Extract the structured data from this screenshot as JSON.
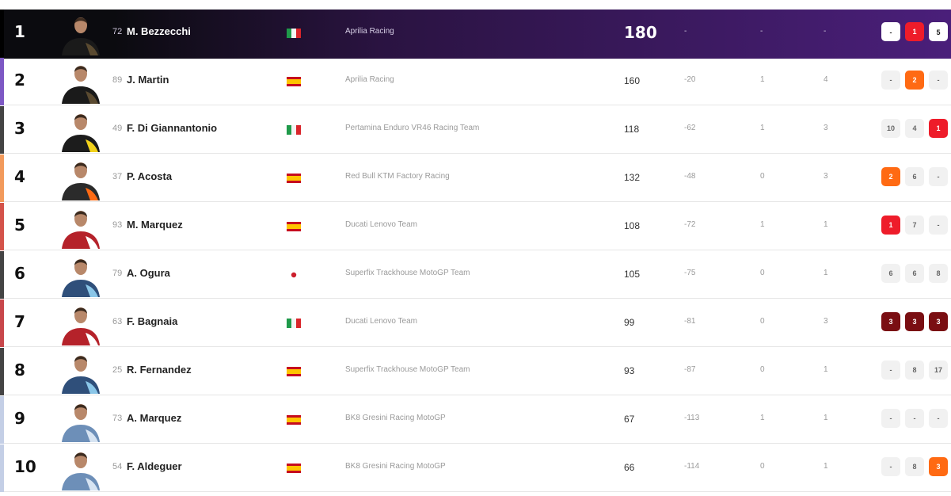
{
  "colors": {
    "leader_bg": "#2a1341",
    "row_accents": [
      "#000000",
      "#7d58c4",
      "#444444",
      "#f29a5c",
      "#d4534a",
      "#444444",
      "#c8474b",
      "#444444",
      "#c4cfe6",
      "#c4cfe6"
    ],
    "form_orange": "#ff6a13",
    "form_red": "#ee1c2a",
    "form_darkred": "#7a0e12",
    "form_grey": "#ececec"
  },
  "rows": [
    {
      "pos": "1",
      "num": "72",
      "rider": "M. Bezzecchi",
      "flag": "it",
      "team": "Aprilia Racing",
      "pts": "180",
      "gap": "-",
      "wins": "-",
      "pods": "-",
      "avatar": "black",
      "form": [
        {
          "label": "-",
          "style": "white"
        },
        {
          "label": "1",
          "style": "red"
        },
        {
          "label": "5",
          "style": "white"
        }
      ]
    },
    {
      "pos": "2",
      "num": "89",
      "rider": "J. Martin",
      "flag": "es",
      "team": "Aprilia Racing",
      "pts": "160",
      "gap": "-20",
      "wins": "1",
      "pods": "4",
      "avatar": "black",
      "form": [
        {
          "label": "-",
          "style": "grey"
        },
        {
          "label": "2",
          "style": "orange"
        },
        {
          "label": "-",
          "style": "grey"
        }
      ]
    },
    {
      "pos": "3",
      "num": "49",
      "rider": "F. Di Giannantonio",
      "flag": "it",
      "team": "Pertamina Enduro VR46 Racing Team",
      "pts": "118",
      "gap": "-62",
      "wins": "1",
      "pods": "3",
      "avatar": "yellow",
      "form": [
        {
          "label": "10",
          "style": "grey"
        },
        {
          "label": "4",
          "style": "grey"
        },
        {
          "label": "1",
          "style": "red"
        }
      ]
    },
    {
      "pos": "4",
      "num": "37",
      "rider": "P. Acosta",
      "flag": "es",
      "team": "Red Bull KTM Factory Racing",
      "pts": "132",
      "gap": "-48",
      "wins": "0",
      "pods": "3",
      "avatar": "orange",
      "form": [
        {
          "label": "2",
          "style": "orange"
        },
        {
          "label": "6",
          "style": "grey"
        },
        {
          "label": "-",
          "style": "grey"
        }
      ]
    },
    {
      "pos": "5",
      "num": "93",
      "rider": "M. Marquez",
      "flag": "es",
      "team": "Ducati Lenovo Team",
      "pts": "108",
      "gap": "-72",
      "wins": "1",
      "pods": "1",
      "avatar": "red",
      "form": [
        {
          "label": "1",
          "style": "red"
        },
        {
          "label": "7",
          "style": "grey"
        },
        {
          "label": "-",
          "style": "grey"
        }
      ]
    },
    {
      "pos": "6",
      "num": "79",
      "rider": "A. Ogura",
      "flag": "jp",
      "team": "Superfix Trackhouse MotoGP Team",
      "pts": "105",
      "gap": "-75",
      "wins": "0",
      "pods": "1",
      "avatar": "blue",
      "form": [
        {
          "label": "6",
          "style": "grey"
        },
        {
          "label": "6",
          "style": "grey"
        },
        {
          "label": "8",
          "style": "grey"
        }
      ]
    },
    {
      "pos": "7",
      "num": "63",
      "rider": "F. Bagnaia",
      "flag": "it",
      "team": "Ducati Lenovo Team",
      "pts": "99",
      "gap": "-81",
      "wins": "0",
      "pods": "3",
      "avatar": "red",
      "form": [
        {
          "label": "3",
          "style": "darkred"
        },
        {
          "label": "3",
          "style": "darkred"
        },
        {
          "label": "3",
          "style": "darkred"
        }
      ]
    },
    {
      "pos": "8",
      "num": "25",
      "rider": "R. Fernandez",
      "flag": "es",
      "team": "Superfix Trackhouse MotoGP Team",
      "pts": "93",
      "gap": "-87",
      "wins": "0",
      "pods": "1",
      "avatar": "blue",
      "form": [
        {
          "label": "-",
          "style": "grey"
        },
        {
          "label": "8",
          "style": "grey"
        },
        {
          "label": "17",
          "style": "grey"
        }
      ]
    },
    {
      "pos": "9",
      "num": "73",
      "rider": "A. Marquez",
      "flag": "es",
      "team": "BK8 Gresini Racing MotoGP",
      "pts": "67",
      "gap": "-113",
      "wins": "1",
      "pods": "1",
      "avatar": "lightblue",
      "form": [
        {
          "label": "-",
          "style": "grey"
        },
        {
          "label": "-",
          "style": "grey"
        },
        {
          "label": "-",
          "style": "grey"
        }
      ]
    },
    {
      "pos": "10",
      "num": "54",
      "rider": "F. Aldeguer",
      "flag": "es",
      "team": "BK8 Gresini Racing MotoGP",
      "pts": "66",
      "gap": "-114",
      "wins": "0",
      "pods": "1",
      "avatar": "lightblue",
      "form": [
        {
          "label": "-",
          "style": "grey"
        },
        {
          "label": "8",
          "style": "grey"
        },
        {
          "label": "3",
          "style": "orange"
        }
      ]
    }
  ]
}
